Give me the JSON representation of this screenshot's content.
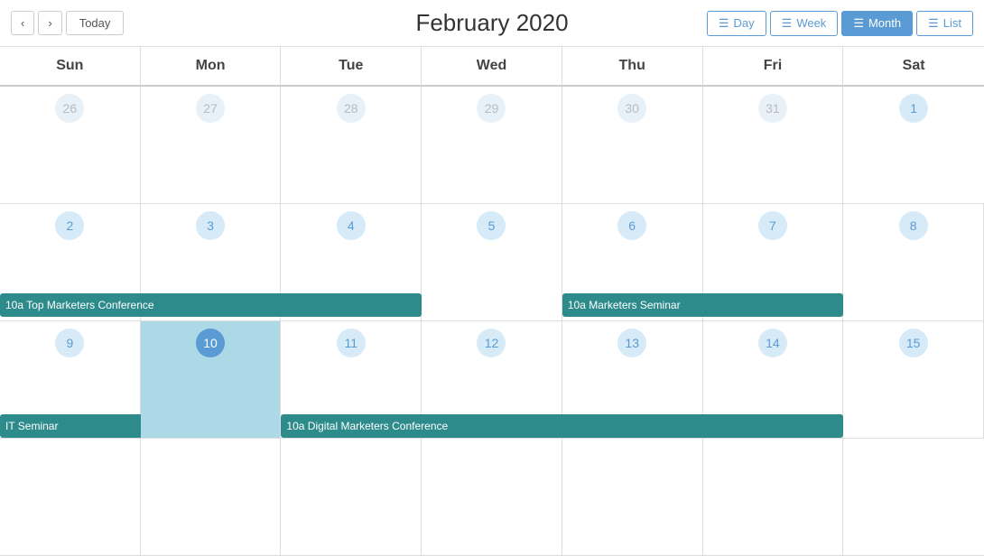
{
  "header": {
    "title": "February 2020",
    "nav": {
      "prev_label": "‹",
      "next_label": "›",
      "today_label": "Today"
    },
    "views": [
      {
        "id": "day",
        "label": "Day",
        "icon": "☰",
        "active": false
      },
      {
        "id": "week",
        "label": "Week",
        "icon": "☰",
        "active": false
      },
      {
        "id": "month",
        "label": "Month",
        "icon": "☰",
        "active": true
      },
      {
        "id": "list",
        "label": "List",
        "icon": "☰",
        "active": false
      }
    ]
  },
  "calendar": {
    "day_headers": [
      "Sun",
      "Mon",
      "Tue",
      "Wed",
      "Thu",
      "Fri",
      "Sat"
    ],
    "weeks": [
      {
        "days": [
          {
            "num": "26",
            "type": "other"
          },
          {
            "num": "27",
            "type": "other"
          },
          {
            "num": "28",
            "type": "other"
          },
          {
            "num": "29",
            "type": "other"
          },
          {
            "num": "30",
            "type": "other"
          },
          {
            "num": "31",
            "type": "other"
          },
          {
            "num": "1",
            "type": "current"
          }
        ],
        "events": []
      },
      {
        "days": [
          {
            "num": "2",
            "type": "current"
          },
          {
            "num": "3",
            "type": "current"
          },
          {
            "num": "4",
            "type": "current"
          },
          {
            "num": "5",
            "type": "current"
          },
          {
            "num": "6",
            "type": "current"
          },
          {
            "num": "7",
            "type": "current"
          },
          {
            "num": "8",
            "type": "current"
          }
        ],
        "events": [
          {
            "label": "10a Top Marketers Conference",
            "startCol": 0,
            "spanCols": 3,
            "color": "teal"
          },
          {
            "label": "10a Marketers Seminar",
            "startCol": 4,
            "spanCols": 2,
            "color": "teal"
          }
        ]
      },
      {
        "days": [
          {
            "num": "9",
            "type": "current"
          },
          {
            "num": "10",
            "type": "today"
          },
          {
            "num": "11",
            "type": "current"
          },
          {
            "num": "12",
            "type": "current"
          },
          {
            "num": "13",
            "type": "current"
          },
          {
            "num": "14",
            "type": "current"
          },
          {
            "num": "15",
            "type": "current"
          }
        ],
        "events": [
          {
            "label": "IT Seminar",
            "startCol": 0,
            "spanCols": 1,
            "color": "teal",
            "partial": true
          },
          {
            "label": "10a Digital Marketers Conference",
            "startCol": 2,
            "spanCols": 4,
            "color": "teal",
            "partial": true
          }
        ],
        "highlightCols": [
          1
        ]
      }
    ]
  },
  "colors": {
    "teal": "#2e8b8b",
    "blue": "#5b9bd5",
    "highlight_bg": "#add8e6",
    "today_bg": "#5b9bd5"
  }
}
